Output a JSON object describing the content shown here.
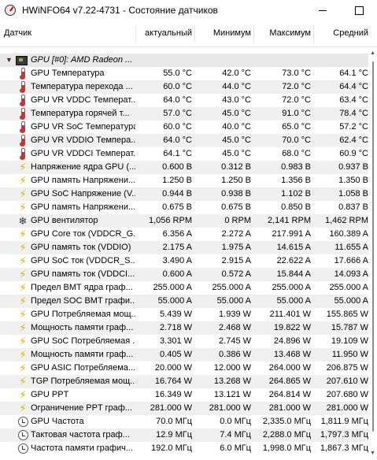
{
  "window": {
    "title": "HWiNFO64 v7.22-4731 - Состояние датчиков"
  },
  "columns": {
    "sensor": "Датчик",
    "current": "актуальный",
    "min": "Минимум",
    "max": "Максимум",
    "avg": "Средний"
  },
  "group": {
    "label": "GPU [#0]: AMD Radeon ..."
  },
  "rows": [
    {
      "icon": "thermometer-icon",
      "name": "GPU Температура",
      "cur": "55.0 °C",
      "min": "42.0 °C",
      "max": "73.0 °C",
      "avg": "64.1 °C"
    },
    {
      "icon": "thermometer-icon",
      "name": "Температура перехода ...",
      "cur": "60.0 °C",
      "min": "44.0 °C",
      "max": "72.0 °C",
      "avg": "64.4 °C"
    },
    {
      "icon": "thermometer-icon",
      "name": "GPU VR VDDC Температ...",
      "cur": "64.0 °C",
      "min": "43.0 °C",
      "max": "72.0 °C",
      "avg": "63.4 °C"
    },
    {
      "icon": "thermometer-icon",
      "name": "Температура горячей т...",
      "cur": "57.0 °C",
      "min": "45.0 °C",
      "max": "91.0 °C",
      "avg": "78.4 °C"
    },
    {
      "icon": "thermometer-icon",
      "name": "GPU VR SoC Температура",
      "cur": "60.0 °C",
      "min": "40.0 °C",
      "max": "65.0 °C",
      "avg": "57.2 °C"
    },
    {
      "icon": "thermometer-icon",
      "name": "GPU VR VDDIO Темпера...",
      "cur": "64.0 °C",
      "min": "45.0 °C",
      "max": "70.0 °C",
      "avg": "62.4 °C"
    },
    {
      "icon": "thermometer-icon",
      "name": "GPU VR VDDCI Температ...",
      "cur": "64.1 °C",
      "min": "45.0 °C",
      "max": "68.0 °C",
      "avg": "60.9 °C"
    },
    {
      "icon": "bolt-icon",
      "name": "Напряжение ядра GPU (...",
      "cur": "0.600 В",
      "min": "0.312 В",
      "max": "0.983 В",
      "avg": "0.937 В"
    },
    {
      "icon": "bolt-icon",
      "name": "GPU память Напряжени...",
      "cur": "1.250 В",
      "min": "1.250 В",
      "max": "1.356 В",
      "avg": "1.350 В"
    },
    {
      "icon": "bolt-icon",
      "name": "GPU SoC Напряжение (V...",
      "cur": "0.944 В",
      "min": "0.938 В",
      "max": "1.102 В",
      "avg": "1.058 В"
    },
    {
      "icon": "bolt-icon",
      "name": "GPU память Напряжени...",
      "cur": "0.675 В",
      "min": "0.675 В",
      "max": "0.850 В",
      "avg": "0.837 В"
    },
    {
      "icon": "fan-icon",
      "name": "GPU вентилятор",
      "cur": "1,056 RPM",
      "min": "0 RPM",
      "max": "2,141 RPM",
      "avg": "1,462 RPM"
    },
    {
      "icon": "bolt-icon",
      "name": "GPU Core ток (VDDCR_G...",
      "cur": "6.356 A",
      "min": "2.272 A",
      "max": "217.991 A",
      "avg": "160.389 A"
    },
    {
      "icon": "bolt-icon",
      "name": "GPU память ток (VDDIO)",
      "cur": "2.175 A",
      "min": "1.975 A",
      "max": "14.615 A",
      "avg": "11.655 A"
    },
    {
      "icon": "bolt-icon",
      "name": "GPU SoC ток (VDDCR_S...",
      "cur": "3.490 A",
      "min": "2.915 A",
      "max": "22.622 A",
      "avg": "17.666 A"
    },
    {
      "icon": "bolt-icon",
      "name": "GPU память ток (VDDCI...",
      "cur": "0.600 A",
      "min": "0.572 A",
      "max": "15.844 A",
      "avg": "14.093 A"
    },
    {
      "icon": "bolt-icon",
      "name": "Предел BMT ядра граф...",
      "cur": "255.000 A",
      "min": "255.000 A",
      "max": "255.000 A",
      "avg": "255.000 A"
    },
    {
      "icon": "bolt-icon",
      "name": "Предел SOC BMT графи...",
      "cur": "55.000 A",
      "min": "55.000 A",
      "max": "55.000 A",
      "avg": "55.000 A"
    },
    {
      "icon": "bolt-icon",
      "name": "GPU Потребляемая мощ...",
      "cur": "5.439 W",
      "min": "1.939 W",
      "max": "211.401 W",
      "avg": "155.865 W"
    },
    {
      "icon": "bolt-icon",
      "name": "Мощность памяти граф...",
      "cur": "2.718 W",
      "min": "2.468 W",
      "max": "19.822 W",
      "avg": "15.787 W"
    },
    {
      "icon": "bolt-icon",
      "name": "GPU SoC Потребляемая ...",
      "cur": "3.301 W",
      "min": "2.745 W",
      "max": "24.896 W",
      "avg": "19.109 W"
    },
    {
      "icon": "bolt-icon",
      "name": "Мощность памяти граф...",
      "cur": "0.405 W",
      "min": "0.386 W",
      "max": "13.468 W",
      "avg": "11.950 W"
    },
    {
      "icon": "bolt-icon",
      "name": "GPU ASIC Потребляема...",
      "cur": "20.000 W",
      "min": "12.000 W",
      "max": "264.000 W",
      "avg": "206.875 W"
    },
    {
      "icon": "bolt-icon",
      "name": "TGP Потребляемая мощ...",
      "cur": "16.764 W",
      "min": "13.268 W",
      "max": "264.865 W",
      "avg": "207.610 W"
    },
    {
      "icon": "bolt-icon",
      "name": "GPU PPT",
      "cur": "16.349 W",
      "min": "13.121 W",
      "max": "264.814 W",
      "avg": "207.680 W"
    },
    {
      "icon": "bolt-icon",
      "name": "Ограничение PPT граф...",
      "cur": "281.000 W",
      "min": "281.000 W",
      "max": "281.000 W",
      "avg": "281.000 W"
    },
    {
      "icon": "clock-icon",
      "name": "GPU Частота",
      "cur": "70.0 МГц",
      "min": "0.0 МГц",
      "max": "2,335.0 МГц",
      "avg": "1,811.9 МГц"
    },
    {
      "icon": "clock-icon",
      "name": "Тактовая частота граф...",
      "cur": "12.9 МГц",
      "min": "7.4 МГц",
      "max": "2,288.0 МГц",
      "avg": "1,797.3 МГц"
    },
    {
      "icon": "clock-icon",
      "name": "Частота памяти графич...",
      "cur": "192.0 МГц",
      "min": "6.0 МГц",
      "max": "1,998.0 МГц",
      "avg": "1,867.3 МГц"
    }
  ]
}
